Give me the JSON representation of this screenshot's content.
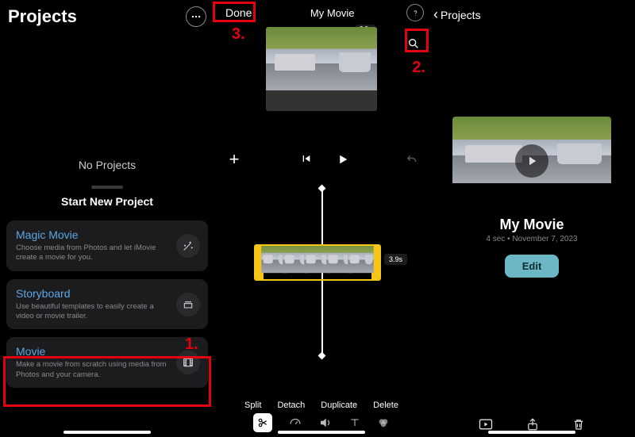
{
  "left": {
    "title": "Projects",
    "no_projects": "No Projects",
    "sheet_title": "Start New Project",
    "cards": [
      {
        "title": "Magic Movie",
        "desc": "Choose media from Photos and let iMovie create a movie for you."
      },
      {
        "title": "Storyboard",
        "desc": "Use beautiful templates to easily create a video or movie trailer."
      },
      {
        "title": "Movie",
        "desc": "Make a movie from scratch using media from Photos and your camera."
      }
    ]
  },
  "mid": {
    "done_label": "Done",
    "title": "My Movie",
    "clip_len": "3.9s",
    "ops": {
      "split": "Split",
      "detach": "Detach",
      "duplicate": "Duplicate",
      "delete": "Delete"
    }
  },
  "right": {
    "back_label": "Projects",
    "movie_title": "My Movie",
    "subtitle": "4 sec • November 7, 2023",
    "edit_label": "Edit"
  },
  "annotations": {
    "n1": "1.",
    "n2": "2.",
    "n3": "3."
  }
}
